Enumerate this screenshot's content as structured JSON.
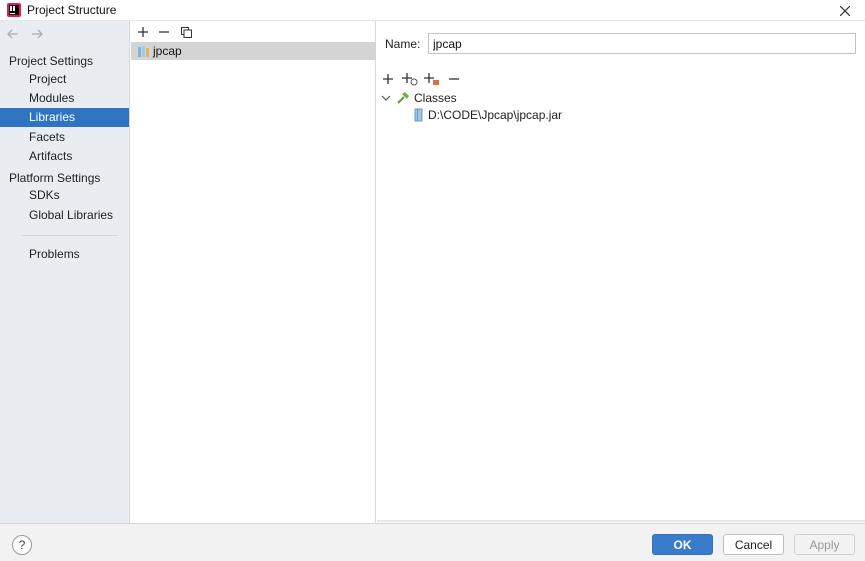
{
  "window": {
    "title": "Project Structure"
  },
  "sidebar": {
    "project_settings_label": "Project Settings",
    "project_items": [
      {
        "label": "Project"
      },
      {
        "label": "Modules"
      },
      {
        "label": "Libraries",
        "selected": true
      },
      {
        "label": "Facets"
      },
      {
        "label": "Artifacts"
      }
    ],
    "platform_settings_label": "Platform Settings",
    "platform_items": [
      {
        "label": "SDKs"
      },
      {
        "label": "Global Libraries"
      }
    ],
    "problems_label": "Problems"
  },
  "libraries": {
    "items": [
      {
        "label": "jpcap",
        "selected": true
      }
    ]
  },
  "detail": {
    "name_label": "Name:",
    "name_value": "jpcap",
    "tree": {
      "root_label": "Classes",
      "children": [
        {
          "label": "D:\\CODE\\Jpcap\\jpcap.jar"
        }
      ]
    }
  },
  "footer": {
    "help_label": "?",
    "ok_label": "OK",
    "cancel_label": "Cancel",
    "apply_label": "Apply"
  },
  "colors": {
    "selection": "#2f74c0",
    "sidebar_bg": "#e9edf2",
    "ok_button": "#3a7ccb"
  }
}
